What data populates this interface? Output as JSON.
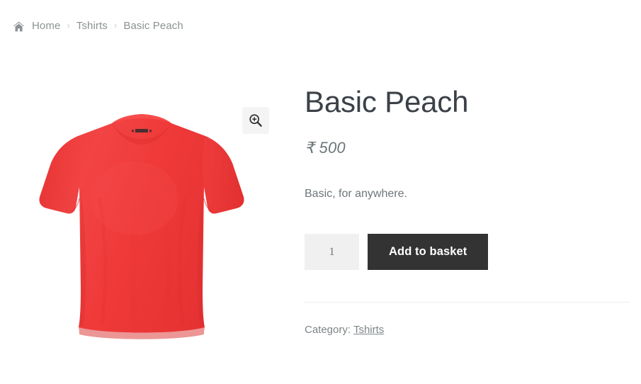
{
  "breadcrumb": {
    "home_icon": "home-icon",
    "items": [
      {
        "label": "Home",
        "type": "link"
      },
      {
        "label": "Tshirts",
        "type": "link"
      },
      {
        "label": "Basic Peach",
        "type": "current"
      }
    ],
    "separator": "›"
  },
  "gallery": {
    "zoom_icon": "zoom-in-icon",
    "image_alt": "Basic Peach red t-shirt",
    "shirt_color": "#F03A3A",
    "shirt_shadow": "#D92D2D"
  },
  "product": {
    "title": "Basic Peach",
    "price": "₹ 500",
    "currency_symbol": "₹",
    "price_amount": "500",
    "short_description": "Basic, for anywhere."
  },
  "cart": {
    "quantity_value": "1",
    "quantity_placeholder": "1",
    "add_to_basket_label": "Add to basket"
  },
  "meta": {
    "category_label": "Category:",
    "category_value": "Tshirts"
  },
  "colors": {
    "button_bg": "#333333",
    "qty_bg": "#f0f0f0",
    "text_muted": "#6d7679",
    "title": "#3b4147",
    "divider": "#ececec"
  }
}
